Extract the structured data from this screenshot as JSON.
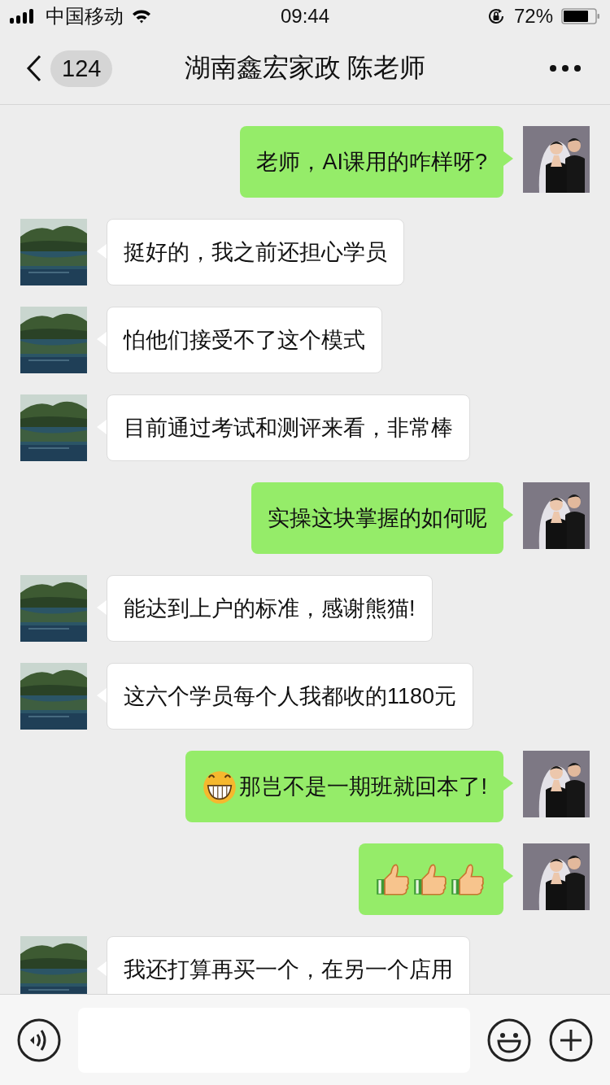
{
  "status_bar": {
    "carrier": "中国移动",
    "time": "09:44",
    "battery": "72%"
  },
  "nav": {
    "unread": "124",
    "title": "湖南鑫宏家政 陈老师"
  },
  "messages": [
    {
      "kind": "outgoing",
      "text": "老师，AI课用的咋样呀?"
    },
    {
      "kind": "incoming",
      "text": "挺好的，我之前还担心学员"
    },
    {
      "kind": "incoming",
      "text": "怕他们接受不了这个模式"
    },
    {
      "kind": "incoming",
      "text": "目前通过考试和测评来看，非常棒"
    },
    {
      "kind": "outgoing",
      "text": "实操这块掌握的如何呢"
    },
    {
      "kind": "incoming",
      "text": "能达到上户的标准，感谢熊猫!"
    },
    {
      "kind": "incoming",
      "text": "这六个学员每个人我都收的1180元"
    },
    {
      "kind": "outgoing",
      "emojis": [
        {
          "kind": "grin"
        }
      ],
      "text": "那岂不是一期班就回本了!"
    },
    {
      "kind": "outgoing",
      "emojis": [
        {
          "kind": "thumbsup"
        },
        {
          "kind": "thumbsup"
        },
        {
          "kind": "thumbsup"
        }
      ]
    },
    {
      "kind": "incoming",
      "text": "我还打算再买一个，在另一个店用"
    }
  ]
}
